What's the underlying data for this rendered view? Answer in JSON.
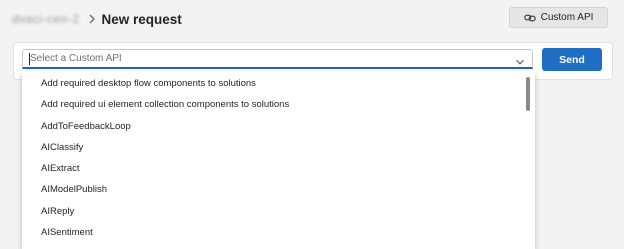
{
  "header": {
    "environment": "dvaci-cen-2",
    "title": "New request",
    "custom_api_label": "Custom API"
  },
  "request": {
    "placeholder": "Select a Custom API",
    "send_label": "Send"
  },
  "dropdown": {
    "options": [
      "Add required desktop flow components to solutions",
      "Add required ui element collection components to solutions",
      "AddToFeedbackLoop",
      "AIClassify",
      "AIExtract",
      "AIModelPublish",
      "AIReply",
      "AISentiment"
    ]
  },
  "colors": {
    "accent": "#1f6ec4",
    "focus_underline": "#2266b8",
    "background": "#f3f3f3"
  },
  "icons": {
    "breadcrumb_separator": "chevron-right-icon",
    "custom_api": "link-icon",
    "select": "chevron-down-icon"
  }
}
